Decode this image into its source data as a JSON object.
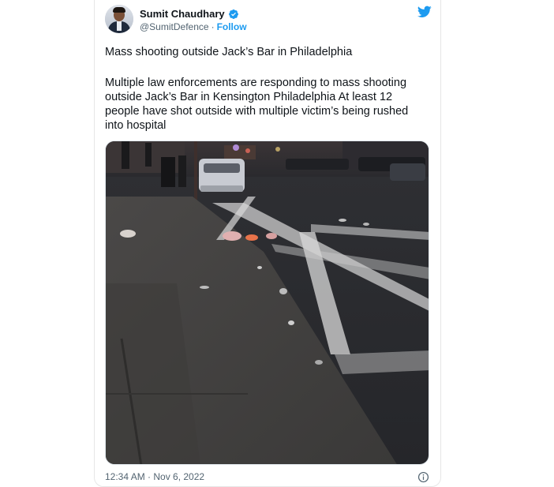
{
  "tweet": {
    "author_name": "Sumit Chaudhary",
    "handle": "@SumitDefence",
    "separator": "·",
    "follow_label": "Follow",
    "headline": "Mass shooting outside Jack’s Bar in Philadelphia",
    "body": "Multiple law enforcements are responding to mass shooting outside Jack’s Bar in Kensington Philadelphia At least 12 people have shot outside with multiple victim’s being rushed into hospital",
    "timestamp": "12:34 AM · Nov 6, 2022"
  },
  "icons": {
    "verified": "verified-badge-icon",
    "brand": "twitter-bird-icon",
    "info": "info-icon"
  },
  "colors": {
    "accent": "#1d9bf0",
    "text": "#0f1419",
    "muted": "#536471"
  }
}
